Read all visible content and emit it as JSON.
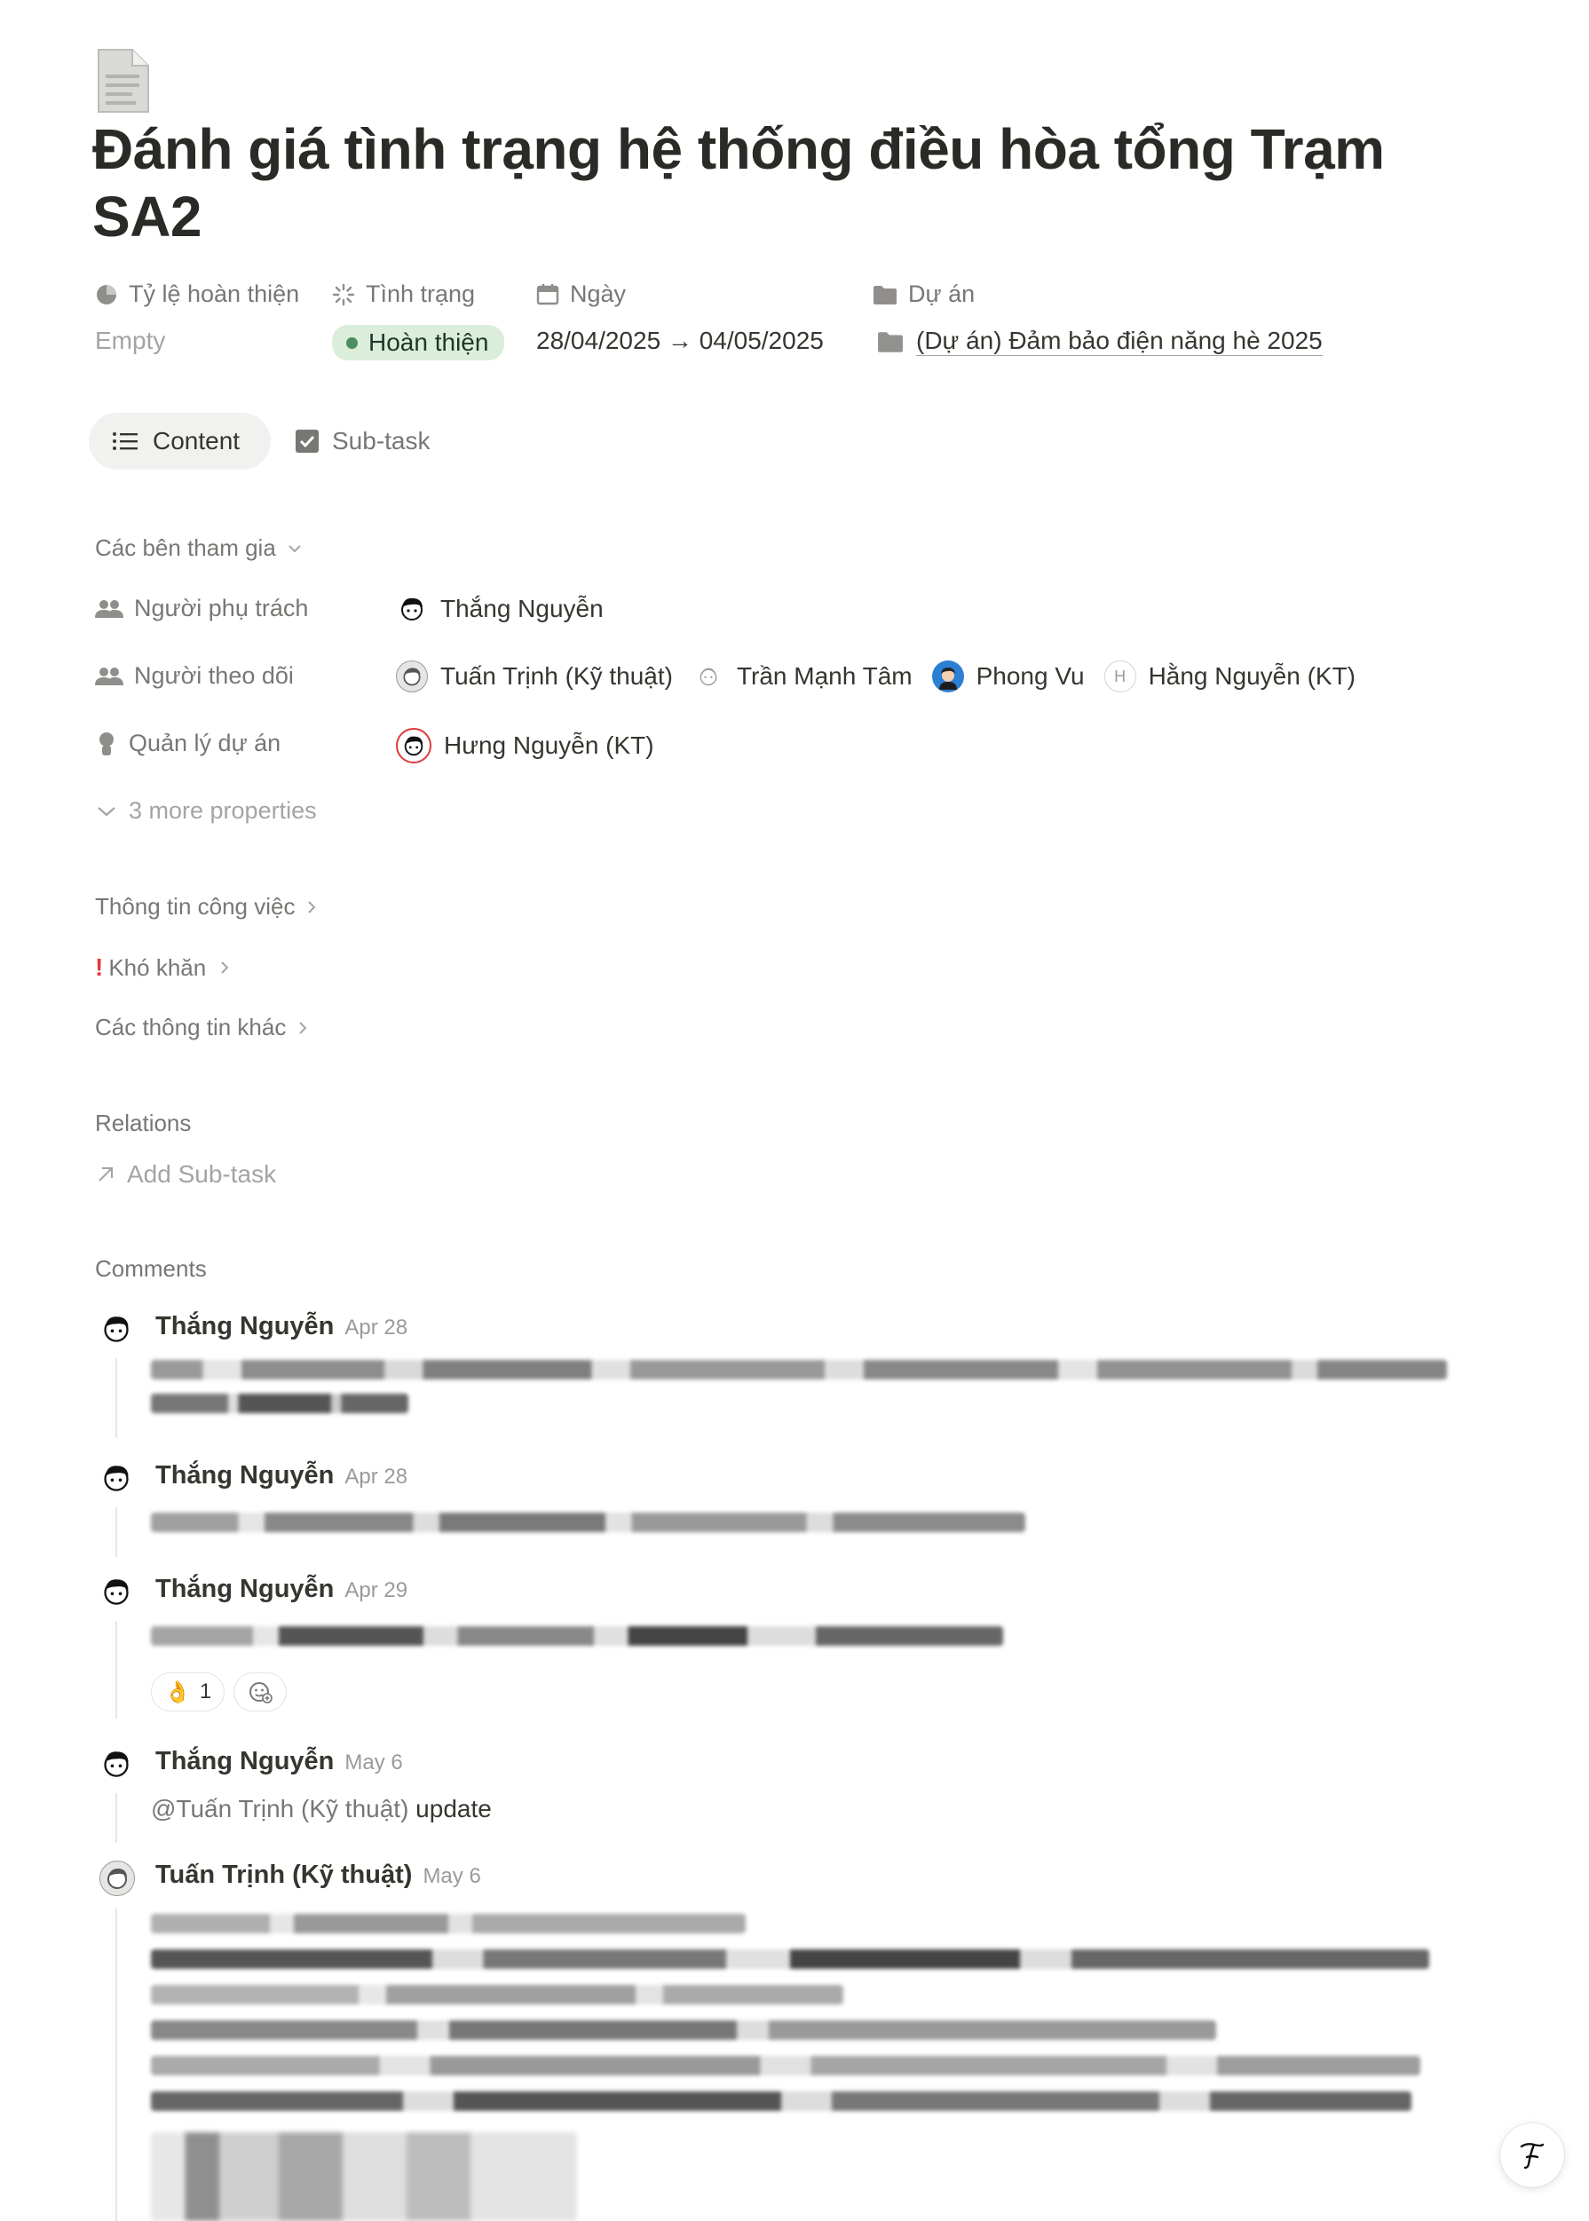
{
  "page": {
    "icon": "document-icon",
    "title": "Đánh giá tình trạng hệ thống điều hòa tổng Trạm SA2"
  },
  "properties": {
    "completion": {
      "label": "Tỷ lệ hoàn thiện",
      "value": "Empty",
      "icon": "pie-icon"
    },
    "status": {
      "label": "Tình trạng",
      "value": "Hoàn thiện",
      "icon": "loader-icon",
      "color": "#dbeddb"
    },
    "date": {
      "label": "Ngày",
      "value": "28/04/2025 → 04/05/2025",
      "icon": "calendar-icon"
    },
    "project": {
      "label": "Dự án",
      "value": "(Dự án) Đảm bảo điện năng hè 2025",
      "icon": "folder-icon"
    }
  },
  "tabs": [
    {
      "label": "Content",
      "icon": "list-icon",
      "active": true
    },
    {
      "label": "Sub-task",
      "icon": "checkbox-icon",
      "active": false
    }
  ],
  "participants": {
    "section_label": "Các bên tham gia",
    "rows": [
      {
        "label": "Người phụ trách",
        "people": [
          "Thắng Nguyễn"
        ]
      },
      {
        "label": "Người theo dõi",
        "people": [
          "Tuấn Trịnh (Kỹ thuật)",
          "Trần Mạnh Tâm",
          "Phong Vu",
          "Hằng Nguyễn (KT)"
        ]
      },
      {
        "label": "Quản lý dự án",
        "people": [
          "Hưng Nguyễn (KT)"
        ]
      }
    ],
    "avatar_letter": "H",
    "more_label": "3 more properties"
  },
  "sections": [
    {
      "label": "Thông tin công việc"
    },
    {
      "label": "Khó khăn",
      "prefix": "!"
    },
    {
      "label": "Các thông tin khác"
    }
  ],
  "relations": {
    "label": "Relations",
    "add_label": "Add Sub-task"
  },
  "comments": {
    "label": "Comments",
    "items": [
      {
        "author": "Thắng Nguyễn",
        "date": "Apr 28"
      },
      {
        "author": "Thắng Nguyễn",
        "date": "Apr 28"
      },
      {
        "author": "Thắng Nguyễn",
        "date": "Apr 29",
        "reaction_emoji": "👌",
        "reaction_count": "1"
      },
      {
        "author": "Thắng Nguyễn",
        "date": "May 6",
        "mention": "@Tuấn Trịnh (Kỹ thuật)",
        "text": " update"
      },
      {
        "author": "Tuấn Trịnh (Kỹ thuật)",
        "date": "May 6"
      }
    ]
  }
}
